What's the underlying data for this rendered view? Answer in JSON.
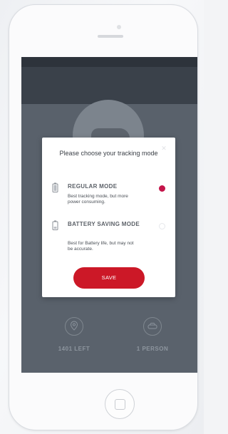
{
  "modal": {
    "title": "Please choose your tracking mode",
    "options": [
      {
        "title": "REGULAR MODE",
        "description": "Best tracking mode, but more power consuming.",
        "selected": true,
        "icon": "battery-full-icon"
      },
      {
        "title": "BATTERY SAVING MODE",
        "description": "Best for Battery life, but may not be accurate.",
        "selected": false,
        "icon": "battery-low-icon"
      }
    ],
    "save_label": "SAVE"
  },
  "stats": [
    {
      "value": "1401 LEFT",
      "icon": "location-pin-icon"
    },
    {
      "value": "1 PERSON",
      "icon": "car-icon"
    }
  ],
  "colors": {
    "accent": "#cc1827",
    "radio_selected": "#c4154a",
    "screen_dim": "#59616b"
  }
}
